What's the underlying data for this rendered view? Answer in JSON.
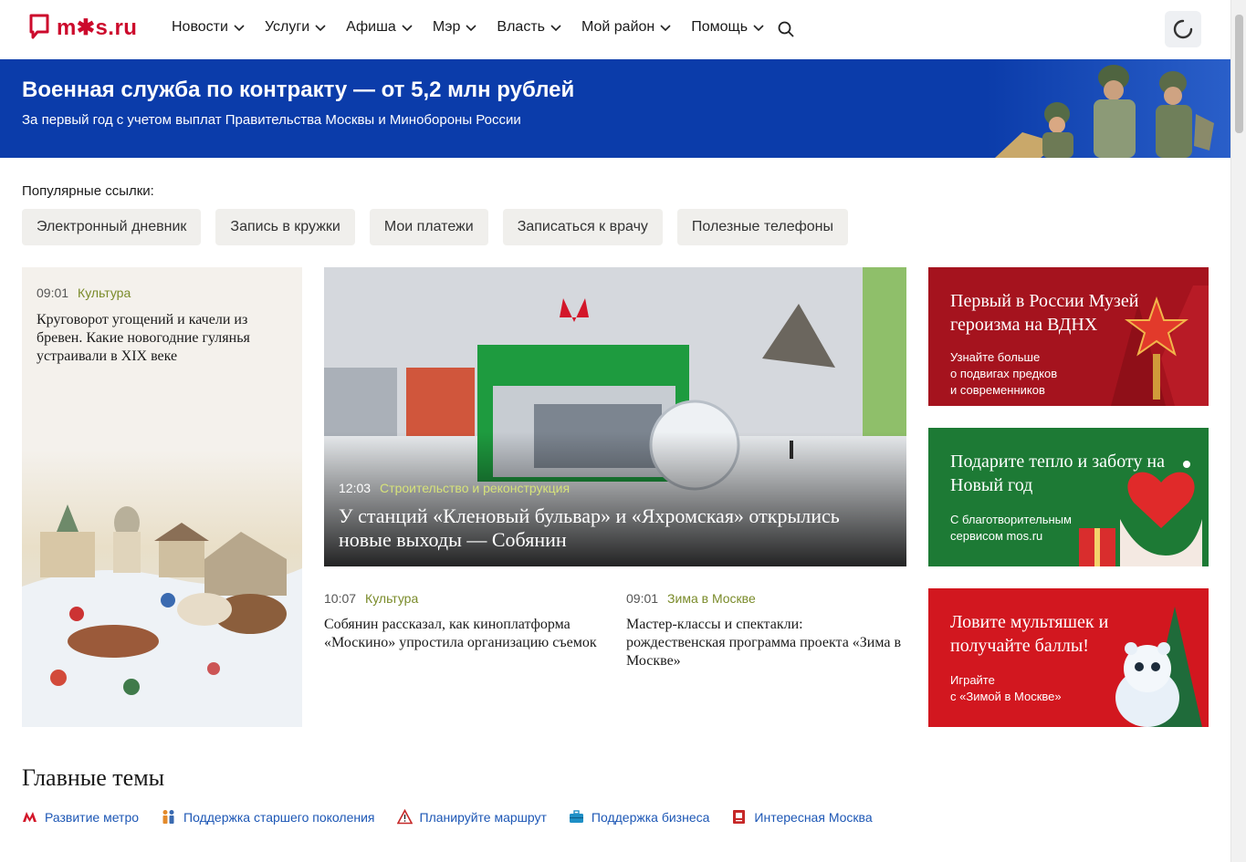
{
  "header": {
    "logo_text": "m✱s.ru",
    "nav": [
      "Новости",
      "Услуги",
      "Афиша",
      "Мэр",
      "Власть",
      "Мой район",
      "Помощь"
    ]
  },
  "banner": {
    "title": "Военная служба по контракту — от 5,2 млн рублей",
    "subtitle": "За первый год с учетом выплат Правительства Москвы и Минобороны России"
  },
  "popular": {
    "label": "Популярные ссылки:",
    "links": [
      "Электронный дневник",
      "Запись в кружки",
      "Мои платежи",
      "Записаться к врачу",
      "Полезные телефоны"
    ]
  },
  "news": {
    "left": {
      "time": "09:01",
      "category": "Культура",
      "title": "Круговорот угощений и качели из бревен. Какие новогодние гулянья устраивали в XIX веке"
    },
    "main": {
      "time": "12:03",
      "category": "Строительство и реконструкция",
      "title": "У станций «Кленовый бульвар» и «Яхромская» открылись новые выходы — Собянин"
    },
    "small": [
      {
        "time": "10:07",
        "category": "Культура",
        "title": "Собянин рассказал, как киноплатформа «Москино» упростила организацию съемок"
      },
      {
        "time": "09:01",
        "category": "Зима в Москве",
        "title": "Мастер-классы и спектакли: рождественская программа проекта «Зима в Москве»"
      }
    ]
  },
  "promos": [
    {
      "title": "Первый в России Музей героизма на ВДНХ",
      "text_1": "Узнайте больше",
      "text_2": "о подвигах предков",
      "text_3": "и современников",
      "color": "#a5131e"
    },
    {
      "title": "Подарите тепло и заботу на Новый год",
      "text_1": "С благотворительным",
      "text_2": "сервисом mos.ru",
      "color": "#1d7a35"
    },
    {
      "title": "Ловите мультяшек и получайте баллы!",
      "text_1": "Играйте",
      "text_2": "с «Зимой в Москве»",
      "color": "#d2171f"
    }
  ],
  "topics": {
    "title": "Главные темы",
    "items": [
      {
        "label": "Развитие метро",
        "icon": "metro-icon"
      },
      {
        "label": "Поддержка старшего поколения",
        "icon": "people-icon"
      },
      {
        "label": "Планируйте маршрут",
        "icon": "warning-icon"
      },
      {
        "label": "Поддержка бизнеса",
        "icon": "briefcase-icon"
      },
      {
        "label": "Интересная Москва",
        "icon": "book-icon"
      }
    ]
  },
  "colors": {
    "brand": "#cc0a2c",
    "banner": "#0b3caa",
    "link": "#1d57b5",
    "category": "#7a8b2a"
  }
}
